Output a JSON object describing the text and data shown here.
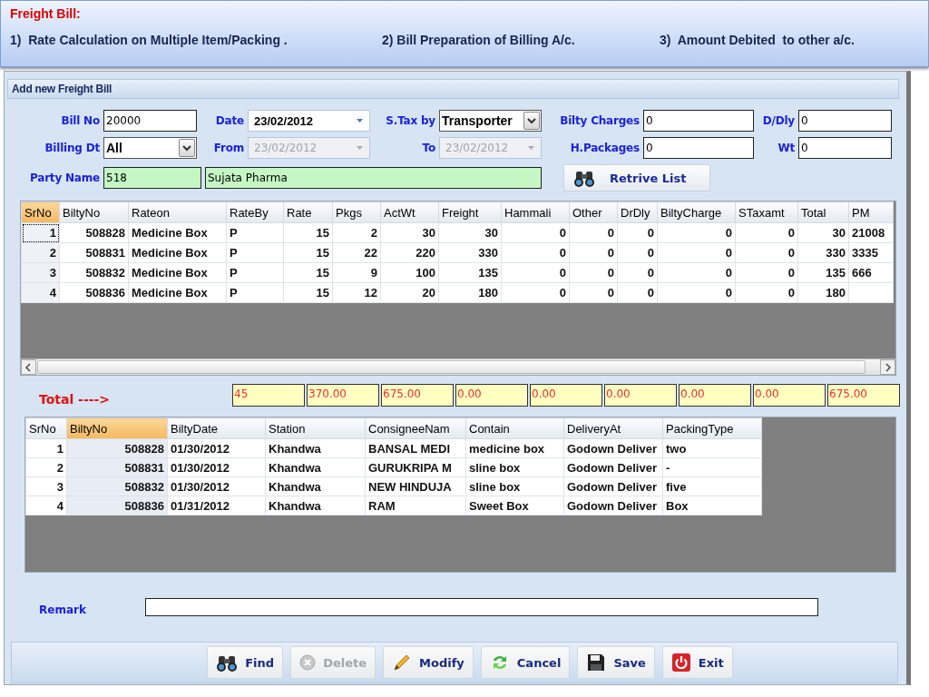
{
  "banner": {
    "title": "Freight Bill:",
    "points": [
      "1)  Rate Calculation on Multiple Item/Packing .",
      "2) Bill Preparation of Billing A/c.",
      "3)  Amount Debited  to other a/c."
    ]
  },
  "window": {
    "title": "Add new Freight Bill"
  },
  "form": {
    "rows": [
      [
        {
          "label": "Bill No",
          "kind": "text",
          "value": "20000",
          "disabled": false
        },
        {
          "label": "Date",
          "kind": "date",
          "value": "23/02/2012",
          "disabled": false
        },
        {
          "label": "S.Tax by",
          "kind": "select",
          "value": "Transporter",
          "disabled": false
        },
        {
          "label": "Bilty Charges",
          "kind": "text",
          "value": "0",
          "disabled": false
        },
        {
          "label": "D/Dly",
          "kind": "text",
          "value": "0",
          "disabled": false
        }
      ],
      [
        {
          "label": "Billing Dt",
          "kind": "select",
          "value": "All",
          "disabled": false
        },
        {
          "label": "From",
          "kind": "date",
          "value": "23/02/2012",
          "disabled": true
        },
        {
          "label": "To",
          "kind": "date",
          "value": "23/02/2012",
          "disabled": true
        },
        {
          "label": "H.Packages",
          "kind": "text",
          "value": "0",
          "disabled": false
        },
        {
          "label": "Wt",
          "kind": "text",
          "value": "0",
          "disabled": false
        }
      ]
    ],
    "party": {
      "label": "Party Name",
      "code": "518",
      "name": "Sujata Pharma"
    },
    "retrieve_button": "Retrive List"
  },
  "items_grid": {
    "columns": [
      {
        "label": "SrNo",
        "selected": true
      },
      {
        "label": "BiltyNo",
        "selected": false
      },
      {
        "label": "Rateon",
        "selected": false
      },
      {
        "label": "RateBy",
        "selected": false
      },
      {
        "label": "Rate",
        "selected": false
      },
      {
        "label": "Pkgs",
        "selected": false
      },
      {
        "label": "ActWt",
        "selected": false
      },
      {
        "label": "Freight",
        "selected": false
      },
      {
        "label": "Hammali",
        "selected": false
      },
      {
        "label": "Other",
        "selected": false
      },
      {
        "label": "DrDly",
        "selected": false
      },
      {
        "label": "BiltyCharge",
        "selected": false
      },
      {
        "label": "STaxamt",
        "selected": false
      },
      {
        "label": "Total",
        "selected": false
      },
      {
        "label": "PM",
        "selected": false
      }
    ],
    "rows": [
      {
        "focused": true,
        "cells": [
          "1",
          "508828",
          "Medicine Box",
          "P",
          "15",
          "2",
          "30",
          "30",
          "0",
          "0",
          "0",
          "0",
          "0",
          "30",
          "21008"
        ]
      },
      {
        "focused": false,
        "cells": [
          "2",
          "508831",
          "Medicine Box",
          "P",
          "15",
          "22",
          "220",
          "330",
          "0",
          "0",
          "0",
          "0",
          "0",
          "330",
          "3335"
        ]
      },
      {
        "focused": false,
        "cells": [
          "3",
          "508832",
          "Medicine Box",
          "P",
          "15",
          "9",
          "100",
          "135",
          "0",
          "0",
          "0",
          "0",
          "0",
          "135",
          "666"
        ]
      },
      {
        "focused": false,
        "cells": [
          "4",
          "508836",
          "Medicine Box",
          "P",
          "15",
          "12",
          "20",
          "180",
          "0",
          "0",
          "0",
          "0",
          "0",
          "180",
          ""
        ]
      }
    ]
  },
  "totals": {
    "label": "Total ---->",
    "values": [
      "45",
      "370.00",
      "675.00",
      "0.00",
      "0.00",
      "0.00",
      "0.00",
      "0.00",
      "675.00"
    ]
  },
  "bilty_grid": {
    "columns": [
      {
        "label": "SrNo",
        "selected": false
      },
      {
        "label": "BiltyNo",
        "selected": true
      },
      {
        "label": "BiltyDate",
        "selected": false
      },
      {
        "label": "Station",
        "selected": false
      },
      {
        "label": "ConsigneeNam",
        "selected": false
      },
      {
        "label": "Contain",
        "selected": false
      },
      {
        "label": "DeliveryAt",
        "selected": false
      },
      {
        "label": "PackingType",
        "selected": false
      }
    ],
    "rows": [
      {
        "cells": [
          "1",
          "508828",
          "01/30/2012",
          "Khandwa",
          "BANSAL MEDI",
          "medicine box",
          "Godown Deliver",
          "two"
        ]
      },
      {
        "cells": [
          "2",
          "508831",
          "01/30/2012",
          "Khandwa",
          "GURUKRIPA M",
          "sline box",
          "Godown Deliver",
          "-"
        ]
      },
      {
        "cells": [
          "3",
          "508832",
          "01/30/2012",
          "Khandwa",
          "NEW HINDUJA",
          "sline box",
          "Godown Deliver",
          "five"
        ]
      },
      {
        "cells": [
          "4",
          "508836",
          "01/31/2012",
          "Khandwa",
          "RAM",
          "Sweet Box",
          "Godown Deliver",
          "Box"
        ]
      }
    ]
  },
  "remark": {
    "label": "Remark"
  },
  "buttons": [
    {
      "label": "Find",
      "disabled": false
    },
    {
      "label": "Delete",
      "disabled": true
    },
    {
      "label": "Modify",
      "disabled": false
    },
    {
      "label": "Cancel",
      "disabled": false
    },
    {
      "label": "Save",
      "disabled": false
    },
    {
      "label": "Exit",
      "disabled": false
    }
  ]
}
